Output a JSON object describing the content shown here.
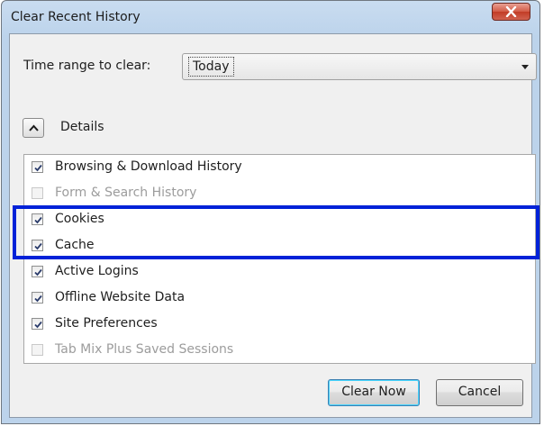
{
  "window": {
    "title": "Clear Recent History"
  },
  "time_range": {
    "label": "Time range to clear:",
    "selected": "Today"
  },
  "details": {
    "label": "Details",
    "expanded": true
  },
  "items": [
    {
      "label": "Browsing & Download History",
      "checked": true,
      "enabled": true
    },
    {
      "label": "Form & Search History",
      "checked": false,
      "enabled": false
    },
    {
      "label": "Cookies",
      "checked": true,
      "enabled": true
    },
    {
      "label": "Cache",
      "checked": true,
      "enabled": true
    },
    {
      "label": "Active Logins",
      "checked": true,
      "enabled": true
    },
    {
      "label": "Offline Website Data",
      "checked": true,
      "enabled": true
    },
    {
      "label": "Site Preferences",
      "checked": true,
      "enabled": true
    },
    {
      "label": "Tab Mix Plus Saved Sessions",
      "checked": false,
      "enabled": false
    }
  ],
  "buttons": {
    "clear_now": "Clear Now",
    "cancel": "Cancel"
  },
  "colors": {
    "highlight": "#0022d8",
    "close_button": "#c23c26"
  }
}
